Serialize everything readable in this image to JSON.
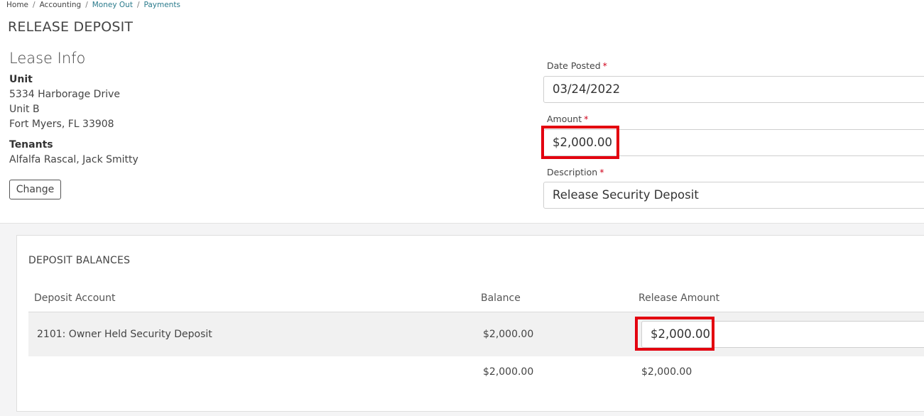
{
  "breadcrumb": {
    "home": "Home",
    "accounting": "Accounting",
    "money_out": "Money Out",
    "payments": "Payments",
    "separator": "/"
  },
  "page_title": "RELEASE DEPOSIT",
  "lease_info": {
    "title": "Lease Info",
    "unit_label": "Unit",
    "address_line1": "5334 Harborage Drive",
    "address_line2": "Unit B",
    "address_line3": "Fort Myers, FL 33908",
    "tenants_label": "Tenants",
    "tenants": "Alfalfa Rascal, Jack Smitty",
    "change_label": "Change"
  },
  "form": {
    "date_posted_label": "Date Posted",
    "date_posted_value": "03/24/2022",
    "amount_label": "Amount",
    "amount_value": "$2,000.00",
    "description_label": "Description",
    "description_value": "Release Security Deposit",
    "required_marker": "*"
  },
  "deposit_balances": {
    "title": "DEPOSIT BALANCES",
    "columns": [
      "Deposit Account",
      "Balance",
      "Release Amount"
    ],
    "rows": [
      {
        "account": "2101: Owner Held Security Deposit",
        "balance": "$2,000.00",
        "release_amount": "$2,000.00"
      }
    ],
    "totals": {
      "balance": "$2,000.00",
      "release_amount": "$2,000.00"
    }
  },
  "colors": {
    "accent_link": "#2a7a8c",
    "required": "#d0021b",
    "highlight": "#e3000f"
  }
}
